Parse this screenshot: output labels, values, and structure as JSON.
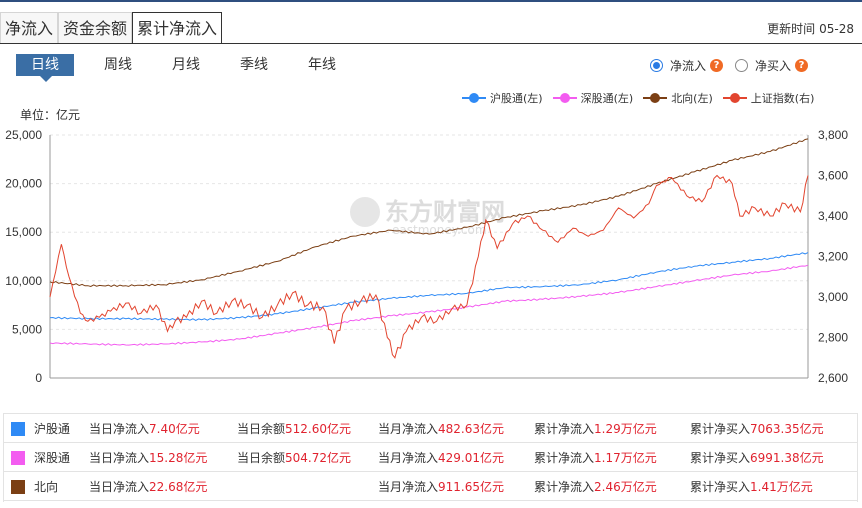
{
  "tabs": [
    {
      "label": "净流入",
      "active": false
    },
    {
      "label": "资金余额",
      "active": false
    },
    {
      "label": "累计净流入",
      "active": true
    }
  ],
  "update": {
    "label": "更新时间",
    "date": "05-28"
  },
  "periods": [
    {
      "label": "日线",
      "active": true
    },
    {
      "label": "周线",
      "active": false
    },
    {
      "label": "月线",
      "active": false
    },
    {
      "label": "季线",
      "active": false
    },
    {
      "label": "年线",
      "active": false
    }
  ],
  "radios": [
    {
      "label": "净流入",
      "checked": true,
      "help_icon": "question-icon"
    },
    {
      "label": "净买入",
      "checked": false,
      "help_icon": "question-icon"
    }
  ],
  "legend": [
    {
      "label": "沪股通(左)",
      "color": "#2f8af5"
    },
    {
      "label": "深股通(左)",
      "color": "#f35cf0"
    },
    {
      "label": "北向(左)",
      "color": "#7b3f14"
    },
    {
      "label": "上证指数(右)",
      "color": "#e2452f"
    }
  ],
  "unit_label": "单位：亿元",
  "watermark": {
    "cn": "东方财富网",
    "en": "eastmoney.com"
  },
  "chart_data": {
    "type": "line",
    "left_axis": {
      "min": 0,
      "max": 25000,
      "ticks": [
        "0",
        "5,000",
        "10,000",
        "15,000",
        "20,000",
        "25,000"
      ]
    },
    "right_axis": {
      "min": 2600,
      "max": 3800,
      "ticks": [
        "2,600",
        "2,800",
        "3,000",
        "3,200",
        "3,400",
        "3,600",
        "3,800"
      ]
    },
    "grid": "horizontal dashed",
    "series": [
      {
        "name": "沪股通(左)",
        "axis": "left",
        "color": "#2f8af5",
        "x": [
          0,
          0.05,
          0.1,
          0.15,
          0.2,
          0.25,
          0.3,
          0.35,
          0.4,
          0.45,
          0.5,
          0.55,
          0.6,
          0.65,
          0.7,
          0.75,
          0.8,
          0.85,
          0.9,
          0.95,
          1.0
        ],
        "values": [
          6200,
          6100,
          6100,
          6050,
          6000,
          6200,
          6600,
          7200,
          7800,
          8200,
          8500,
          8700,
          9300,
          9400,
          9600,
          10100,
          10900,
          11500,
          11900,
          12300,
          12900
        ]
      },
      {
        "name": "深股通(左)",
        "axis": "left",
        "color": "#f35cf0",
        "x": [
          0,
          0.05,
          0.1,
          0.15,
          0.2,
          0.25,
          0.3,
          0.35,
          0.4,
          0.45,
          0.5,
          0.55,
          0.6,
          0.65,
          0.7,
          0.75,
          0.8,
          0.85,
          0.9,
          0.95,
          1.0
        ],
        "values": [
          3600,
          3500,
          3400,
          3500,
          3700,
          4000,
          4600,
          5200,
          5900,
          6400,
          6800,
          7300,
          7900,
          8100,
          8400,
          8800,
          9400,
          10000,
          10600,
          11000,
          11600
        ]
      },
      {
        "name": "北向(左)",
        "axis": "left",
        "color": "#7b3f14",
        "x": [
          0,
          0.05,
          0.1,
          0.15,
          0.2,
          0.25,
          0.3,
          0.35,
          0.4,
          0.45,
          0.5,
          0.55,
          0.6,
          0.65,
          0.7,
          0.75,
          0.8,
          0.85,
          0.9,
          0.95,
          1.0
        ],
        "values": [
          9900,
          9500,
          9500,
          9600,
          10100,
          11000,
          12000,
          13500,
          14600,
          15200,
          14800,
          15500,
          16500,
          17200,
          17800,
          18700,
          20000,
          21200,
          22400,
          23300,
          24600
        ]
      },
      {
        "name": "上证指数(右)",
        "axis": "right",
        "color": "#e2452f",
        "x": [
          0,
          0.015,
          0.025,
          0.04,
          0.05,
          0.065,
          0.08,
          0.1,
          0.12,
          0.14,
          0.155,
          0.165,
          0.18,
          0.2,
          0.22,
          0.24,
          0.26,
          0.28,
          0.3,
          0.32,
          0.34,
          0.36,
          0.375,
          0.39,
          0.41,
          0.43,
          0.445,
          0.455,
          0.47,
          0.49,
          0.51,
          0.53,
          0.55,
          0.565,
          0.575,
          0.59,
          0.61,
          0.63,
          0.65,
          0.67,
          0.69,
          0.71,
          0.73,
          0.75,
          0.77,
          0.79,
          0.8,
          0.82,
          0.84,
          0.86,
          0.88,
          0.9,
          0.91,
          0.93,
          0.95,
          0.97,
          0.99,
          1.0
        ],
        "values": [
          3000,
          3260,
          3100,
          2920,
          2880,
          2900,
          2930,
          2970,
          2920,
          2960,
          2830,
          2880,
          2900,
          2980,
          2920,
          2980,
          2960,
          2900,
          2960,
          3020,
          2960,
          2950,
          2770,
          2940,
          2980,
          3010,
          2800,
          2700,
          2830,
          2900,
          2880,
          2940,
          2960,
          3200,
          3380,
          3240,
          3360,
          3400,
          3330,
          3270,
          3340,
          3300,
          3330,
          3440,
          3390,
          3460,
          3550,
          3590,
          3500,
          3470,
          3600,
          3560,
          3400,
          3440,
          3400,
          3460,
          3420,
          3600
        ]
      }
    ]
  },
  "summary": [
    {
      "name": "沪股通",
      "color": "#2f8af5",
      "c1_label": "当日净流入",
      "c1_value": "7.40亿元",
      "c2_label": "当日余额",
      "c2_value": "512.60亿元",
      "c3_label": "当月净流入",
      "c3_value": "482.63亿元",
      "c4_label": "累计净流入",
      "c4_value": "1.29万亿元",
      "c5_label": "累计净买入",
      "c5_value": "7063.35亿元"
    },
    {
      "name": "深股通",
      "color": "#f35cf0",
      "c1_label": "当日净流入",
      "c1_value": "15.28亿元",
      "c2_label": "当日余额",
      "c2_value": "504.72亿元",
      "c3_label": "当月净流入",
      "c3_value": "429.01亿元",
      "c4_label": "累计净流入",
      "c4_value": "1.17万亿元",
      "c5_label": "累计净买入",
      "c5_value": "6991.38亿元"
    },
    {
      "name": "北向",
      "color": "#7b3f14",
      "c1_label": "当日净流入",
      "c1_value": "22.68亿元",
      "c2_label": "",
      "c2_value": "",
      "c3_label": "当月净流入",
      "c3_value": "911.65亿元",
      "c4_label": "累计净流入",
      "c4_value": "2.46万亿元",
      "c5_label": "累计净买入",
      "c5_value": "1.41万亿元"
    }
  ]
}
